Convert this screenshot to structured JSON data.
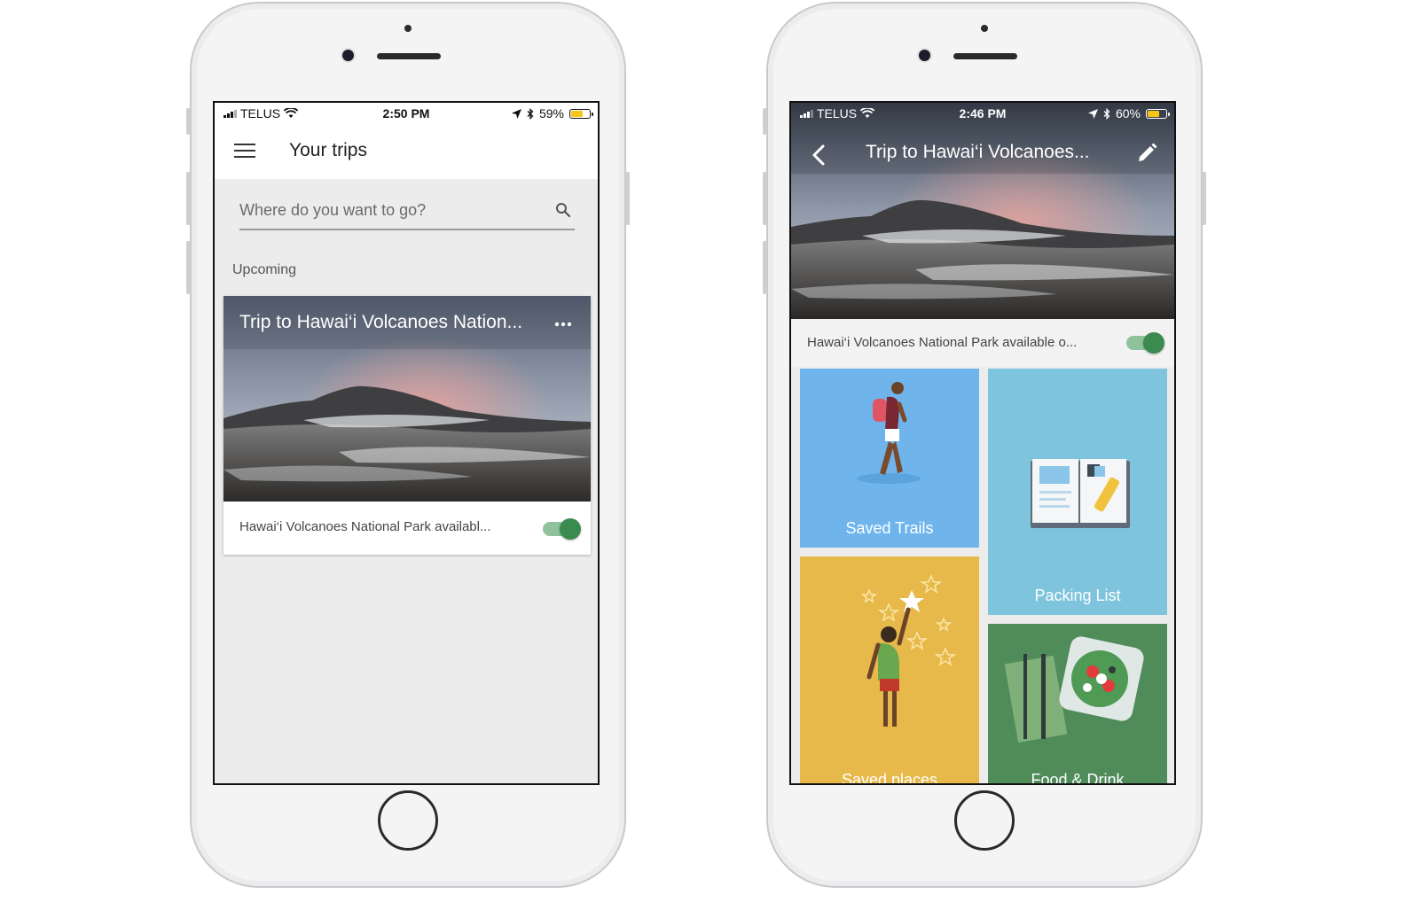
{
  "left_phone": {
    "status": {
      "carrier": "TELUS",
      "time": "2:50 PM",
      "battery": "59%",
      "battery_level": 0.59
    },
    "appbar": {
      "title": "Your trips"
    },
    "search": {
      "placeholder": "Where do you want to go?"
    },
    "section_label": "Upcoming",
    "trip_card": {
      "title": "Trip to Hawai‘i Volcanoes Nation...",
      "offline_label": "Hawai‘i Volcanoes National Park availabl...",
      "offline_enabled": true
    }
  },
  "right_phone": {
    "status": {
      "carrier": "TELUS",
      "time": "2:46 PM",
      "battery": "60%",
      "battery_level": 0.6
    },
    "header": {
      "title": "Trip to Hawai‘i Volcanoes..."
    },
    "offline_label": "Hawai‘i Volcanoes National Park available o...",
    "offline_enabled": true,
    "tiles": [
      {
        "label": "Saved Trails",
        "color": "#6fb5ec"
      },
      {
        "label": "Packing List",
        "color": "#7dc4dc"
      },
      {
        "label": "Saved places",
        "color": "#e7b94a"
      },
      {
        "label": "Food & Drink",
        "color": "#4f8c5a"
      }
    ]
  },
  "colors": {
    "toggle_on": "#3b8a4f",
    "toggle_track": "#8fc29a"
  }
}
